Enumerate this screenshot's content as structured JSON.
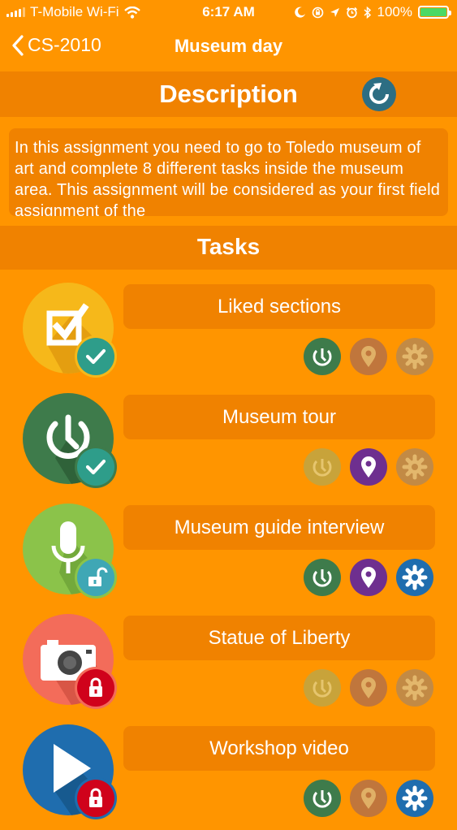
{
  "status_bar": {
    "carrier": "T-Mobile Wi-Fi",
    "time": "6:17 AM",
    "battery": "100%"
  },
  "nav": {
    "back_label": "CS-2010",
    "title": "Museum day"
  },
  "description": {
    "title": "Description",
    "text": "In this assignment you need to go to Toledo museum of art and complete 8 different tasks inside the museum area. This assignment will be considered as your first field assignment of the"
  },
  "tasks_title": "Tasks",
  "tasks": [
    {
      "title": "Liked sections",
      "icon": "checkbox-icon",
      "status": "completed"
    },
    {
      "title": "Museum tour",
      "icon": "timer-icon",
      "status": "completed"
    },
    {
      "title": "Museum guide interview",
      "icon": "microphone-icon",
      "status": "unlocked"
    },
    {
      "title": "Statue of Liberty",
      "icon": "camera-icon",
      "status": "locked"
    },
    {
      "title": "Workshop video",
      "icon": "play-icon",
      "status": "locked"
    }
  ],
  "colors": {
    "background": "#FF9500",
    "panel": "#F08200",
    "timer_active": "#3E7B4B",
    "location_active": "#6E2F8F",
    "settings_active": "#1F6DAE",
    "completed_badge": "#2E9D8A",
    "locked_badge": "#D0021B"
  }
}
